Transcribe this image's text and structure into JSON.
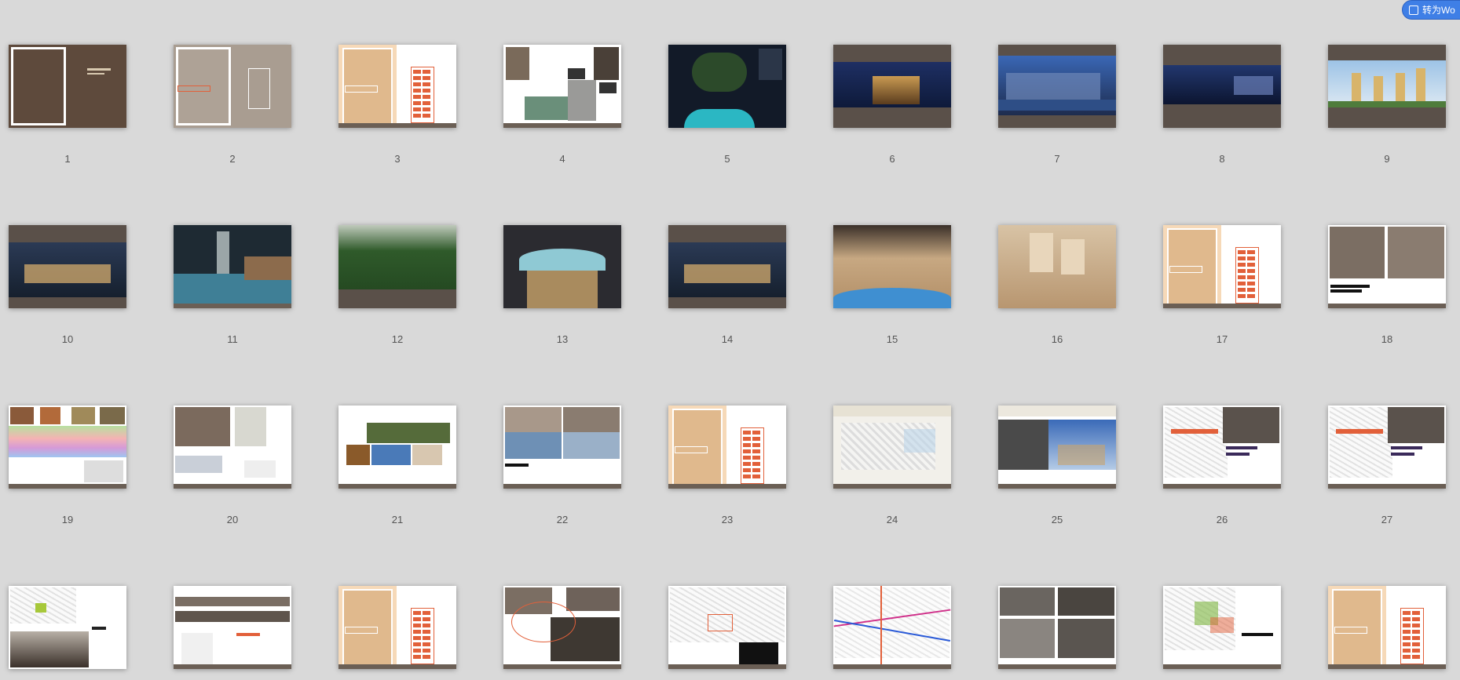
{
  "toolbar": {
    "convert_label": "转为Wo"
  },
  "pages": [
    {
      "n": "1",
      "style": "cover-brown"
    },
    {
      "n": "2",
      "style": "cover-taupe"
    },
    {
      "n": "3",
      "style": "section-tan"
    },
    {
      "n": "4",
      "style": "collage"
    },
    {
      "n": "5",
      "style": "aerial-night"
    },
    {
      "n": "6",
      "style": "skyline-band"
    },
    {
      "n": "7",
      "style": "river-city"
    },
    {
      "n": "8",
      "style": "skyline-band-wide"
    },
    {
      "n": "9",
      "style": "towers-day"
    },
    {
      "n": "10",
      "style": "street-night"
    },
    {
      "n": "11",
      "style": "pool-night"
    },
    {
      "n": "12",
      "style": "garden"
    },
    {
      "n": "13",
      "style": "entrance"
    },
    {
      "n": "14",
      "style": "street-night"
    },
    {
      "n": "15",
      "style": "model-blue"
    },
    {
      "n": "16",
      "style": "model"
    },
    {
      "n": "17",
      "style": "section-tan"
    },
    {
      "n": "18",
      "style": "maps"
    },
    {
      "n": "19",
      "style": "chart-strip"
    },
    {
      "n": "20",
      "style": "collage-plan"
    },
    {
      "n": "21",
      "style": "photo-collage"
    },
    {
      "n": "22",
      "style": "city-photos"
    },
    {
      "n": "23",
      "style": "section-tan"
    },
    {
      "n": "24",
      "style": "sketch"
    },
    {
      "n": "25",
      "style": "bw-sky"
    },
    {
      "n": "26",
      "style": "sketch-map"
    },
    {
      "n": "27",
      "style": "sketch-map"
    },
    {
      "n": "",
      "style": "sketch-skyline"
    },
    {
      "n": "",
      "style": "panoramas"
    },
    {
      "n": "",
      "style": "section-tan"
    },
    {
      "n": "",
      "style": "map-orange"
    },
    {
      "n": "",
      "style": "sketch-table"
    },
    {
      "n": "",
      "style": "lines-map"
    },
    {
      "n": "",
      "style": "bw-grid"
    },
    {
      "n": "",
      "style": "sketch-green"
    },
    {
      "n": "",
      "style": "section-tan"
    }
  ]
}
